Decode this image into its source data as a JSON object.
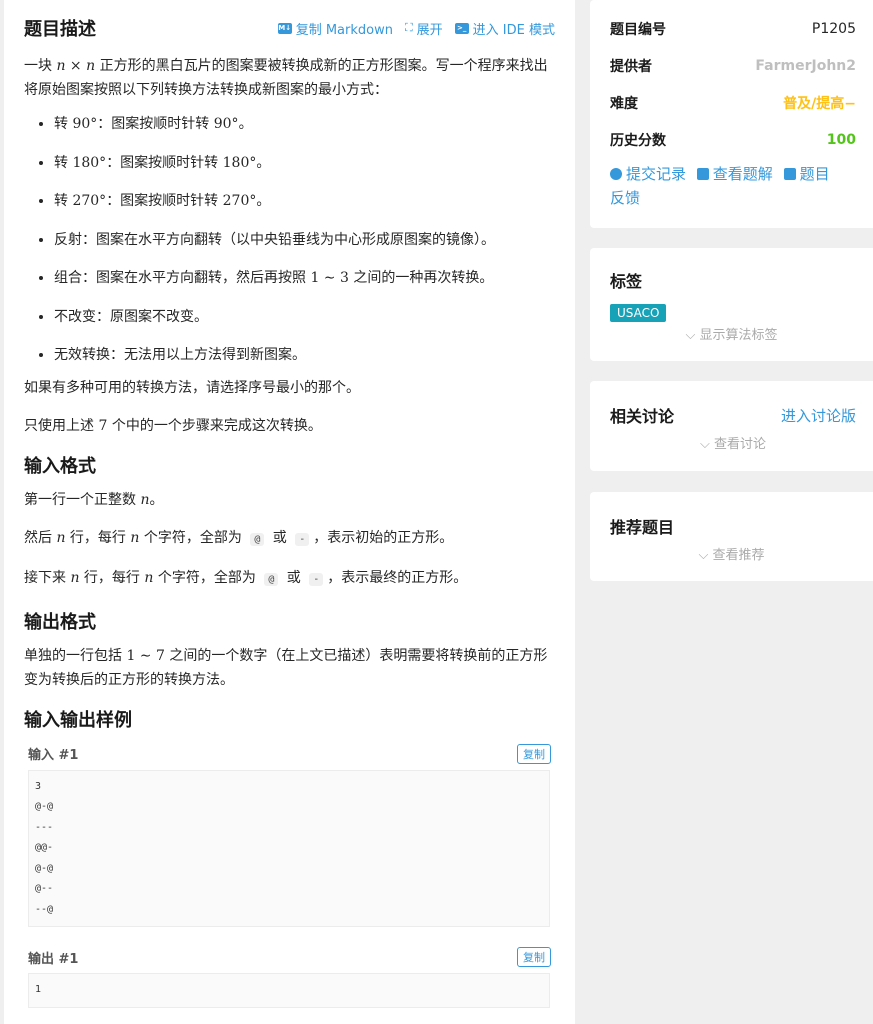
{
  "main": {
    "title": "题目描述",
    "actions": [
      {
        "icon": "markdown-icon",
        "label": "复制 Markdown"
      },
      {
        "icon": "expand-icon",
        "label": "展开"
      },
      {
        "icon": "ide-icon",
        "label": "进入 IDE 模式"
      }
    ],
    "intro_a": "一块 ",
    "intro_b": " 正方形的黑白瓦片的图案要被转换成新的正方形图案。写一个程序来找出将原始图案按照以下列转换方法转换成新图案的最小方式：",
    "intro_math": "n × n",
    "list": [
      {
        "pre": "转 ",
        "math": "90°",
        "post": "：图案按顺时针转 ",
        "math2": "90°",
        "post2": "。"
      },
      {
        "pre": "转 ",
        "math": "180°",
        "post": "：图案按顺时针转 ",
        "math2": "180°",
        "post2": "。"
      },
      {
        "pre": "转 ",
        "math": "270°",
        "post": "：图案按顺时针转 ",
        "math2": "270°",
        "post2": "。"
      },
      {
        "pre": "反射：图案在水平方向翻转（以中央铅垂线为中心形成原图案的镜像）。",
        "math": "",
        "post": "",
        "math2": "",
        "post2": ""
      },
      {
        "pre": "组合：图案在水平方向翻转，然后再按照 ",
        "math": "1 ∼ 3",
        "post": " 之间的一种再次转换。",
        "math2": "",
        "post2": ""
      },
      {
        "pre": "不改变：原图案不改变。",
        "math": "",
        "post": "",
        "math2": "",
        "post2": ""
      },
      {
        "pre": "无效转换：无法用以上方法得到新图案。",
        "math": "",
        "post": "",
        "math2": "",
        "post2": ""
      }
    ],
    "p_multi": "如果有多种可用的转换方法，请选择序号最小的那个。",
    "p_only_a": "只使用上述 ",
    "p_only_num": "7",
    "p_only_b": " 个中的一个步骤来完成这次转换。",
    "input_title": "输入格式",
    "in1_a": "第一行一个正整数 ",
    "in1_b": "。",
    "in2_a": "然后 ",
    "in2_b": " 行，每行 ",
    "in2_c": " 个字符，全部为 ",
    "in2_d": " 或 ",
    "in2_e": "，表示初始的正方形。",
    "in3_a": "接下来 ",
    "in3_b": " 行，每行 ",
    "in3_c": " 个字符，全部为 ",
    "in3_d": " 或 ",
    "in3_e": "，表示最终的正方形。",
    "var_n": "n",
    "code_at": "@",
    "code_dash": "-",
    "output_title": "输出格式",
    "out_a": "单独的一行包括 ",
    "out_math": "1 ∼ 7",
    "out_b": " 之间的一个数字（在上文已描述）表明需要将转换前的正方形变为转换后的正方形的转换方法。",
    "sample_title": "输入输出样例",
    "input1_label": "输入 #1",
    "input1_text": "3\n@-@\n---\n@@-\n@-@\n@--\n--@",
    "output1_label": "输出 #1",
    "output1_text": "1",
    "copy_label": "复制"
  },
  "side": {
    "info": {
      "id_label": "题目编号",
      "id_value": "P1205",
      "provider_label": "提供者",
      "provider_value": "FarmerJohn2",
      "difficulty_label": "难度",
      "difficulty_value": "普及/提高−",
      "score_label": "历史分数",
      "score_value": "100",
      "link_submissions": "提交记录",
      "link_solutions": "查看题解",
      "link_feedback_a": "题目",
      "link_feedback_b": "反馈"
    },
    "tags": {
      "title": "标签",
      "tag": "USACO",
      "show": "显示算法标签"
    },
    "discuss": {
      "title": "相关讨论",
      "enter": "进入讨论版",
      "view": "查看讨论"
    },
    "recommend": {
      "title": "推荐题目",
      "view": "查看推荐"
    }
  },
  "colors": {
    "accent": "#3498db",
    "difficulty": "#ffc116",
    "score": "#52c41a",
    "provider": "#bfbfbf",
    "tag": "#17a2b8"
  }
}
